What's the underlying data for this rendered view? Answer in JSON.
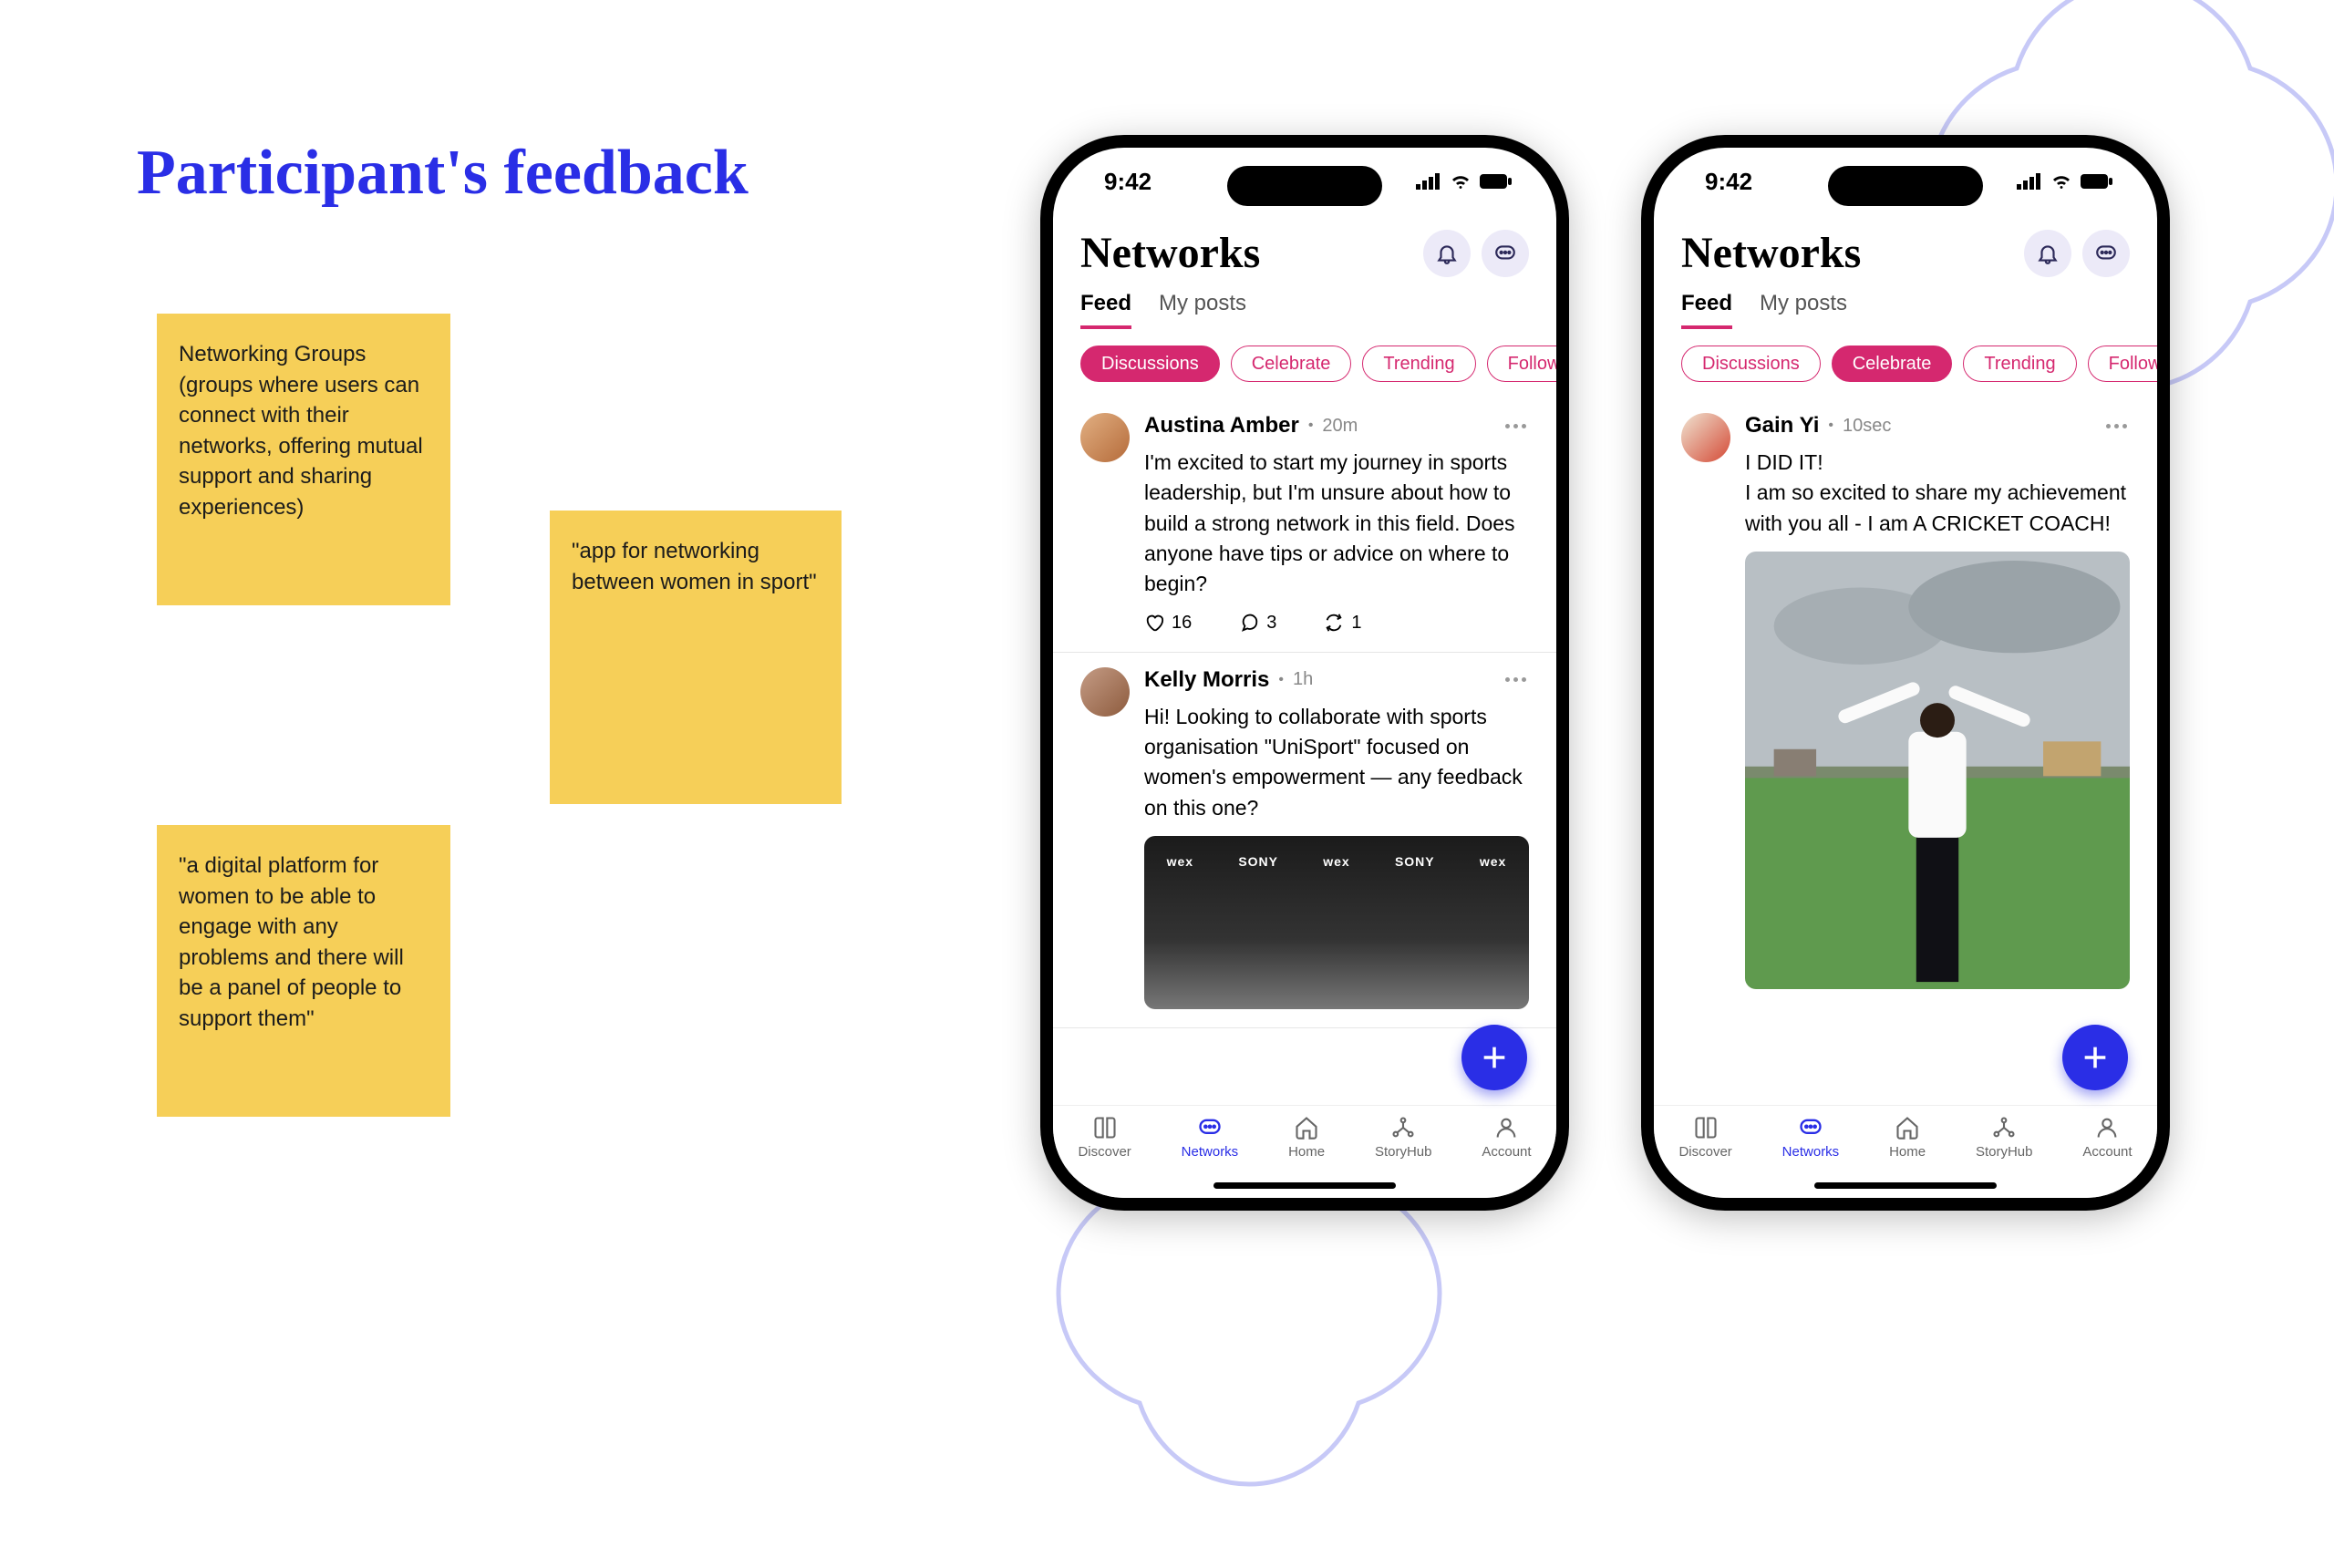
{
  "heading": "Participant's feedback",
  "stickies": {
    "s1": "Networking Groups (groups where users can connect with their networks, offering mutual support and sharing experiences)",
    "s2": "\"app for networking between women in sport\"",
    "s3": "\"a digital platform for women to be able to engage with any problems and there will be a panel of people to support them\""
  },
  "colors": {
    "accent": "#2a2ee6",
    "chip": "#d5286f",
    "sticky": "#f6cf58"
  },
  "statusbar": {
    "time": "9:42"
  },
  "header": {
    "title": "Networks"
  },
  "tabs": {
    "feed": "Feed",
    "myposts": "My posts"
  },
  "chips": {
    "discussions": "Discussions",
    "celebrate": "Celebrate",
    "trending": "Trending",
    "following": "Following"
  },
  "phoneA": {
    "active_tab": "feed",
    "active_chip": "discussions",
    "posts": [
      {
        "author": "Austina Amber",
        "time": "20m",
        "text": "I'm excited to start my journey in sports leadership, but I'm unsure about how to build a strong network in this field. Does anyone have tips or advice on where to begin?",
        "likes": "16",
        "comments": "3",
        "reposts": "1"
      },
      {
        "author": "Kelly Morris",
        "time": "1h",
        "text": "Hi! Looking to collaborate with sports organisation \"UniSport\" focused on women's empowerment — any feedback on this one?",
        "has_image": true,
        "image_brands": [
          "wex",
          "SONY",
          "wex",
          "SONY",
          "wex"
        ]
      }
    ]
  },
  "phoneB": {
    "active_tab": "feed",
    "active_chip": "celebrate",
    "posts": [
      {
        "author": "Gain Yi",
        "time": "10sec",
        "text": "I DID IT!\nI am so excited to share my achievement with you all - I am A CRICKET COACH!",
        "has_image": true
      }
    ]
  },
  "bottomnav": {
    "discover": "Discover",
    "networks": "Networks",
    "home": "Home",
    "storyhub": "StoryHub",
    "account": "Account"
  }
}
